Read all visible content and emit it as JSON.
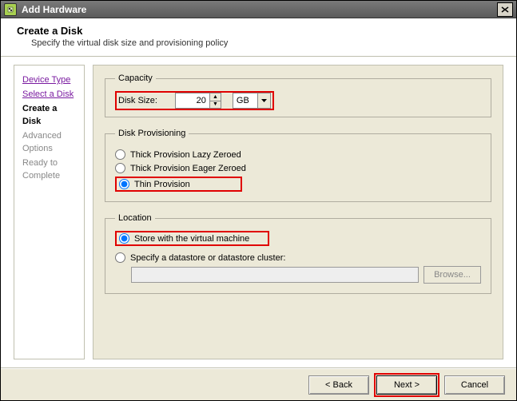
{
  "titlebar": {
    "title": "Add Hardware"
  },
  "header": {
    "title": "Create a Disk",
    "subtitle": "Specify the virtual disk size and provisioning policy"
  },
  "sidebar": {
    "steps": {
      "device_type": "Device Type",
      "select_disk": "Select a Disk",
      "create_disk": "Create a Disk",
      "advanced": "Advanced Options",
      "ready": "Ready to Complete"
    }
  },
  "capacity": {
    "legend": "Capacity",
    "disk_size_label": "Disk Size:",
    "disk_size_value": "20",
    "unit_value": "GB"
  },
  "provisioning": {
    "legend": "Disk Provisioning",
    "options": {
      "lazy": "Thick Provision Lazy Zeroed",
      "eager": "Thick Provision Eager Zeroed",
      "thin": "Thin Provision"
    },
    "selected": "thin"
  },
  "location": {
    "legend": "Location",
    "store_label": "Store with the virtual machine",
    "specify_label": "Specify a datastore or datastore cluster:",
    "browse_label": "Browse...",
    "selected": "store"
  },
  "footer": {
    "back": "< Back",
    "next": "Next >",
    "cancel": "Cancel"
  }
}
